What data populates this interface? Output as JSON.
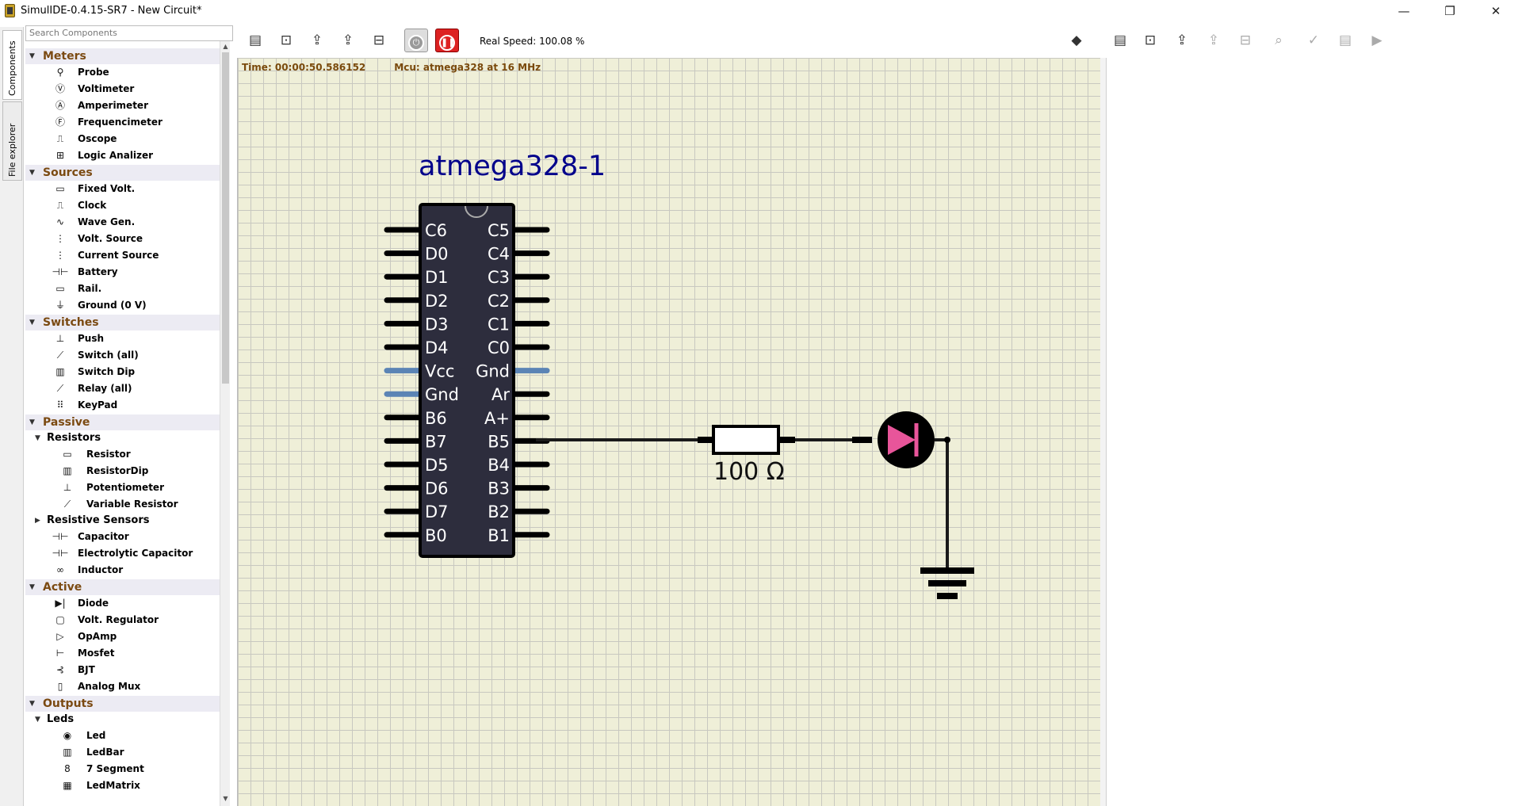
{
  "window": {
    "title": "SimulIDE-0.4.15-SR7  -  New Circuit*",
    "minimize": "—",
    "maximize": "❐",
    "close": "✕"
  },
  "side_tabs": [
    "Components",
    "File explorer"
  ],
  "search": {
    "placeholder": "Search Components"
  },
  "tree": {
    "meters": {
      "label": "Meters",
      "items": [
        "Probe",
        "Voltimeter",
        "Amperimeter",
        "Frequencimeter",
        "Oscope",
        "Logic Analizer"
      ]
    },
    "sources": {
      "label": "Sources",
      "items": [
        "Fixed Volt.",
        "Clock",
        "Wave Gen.",
        "Volt. Source",
        "Current Source",
        "Battery",
        "Rail.",
        "Ground (0 V)"
      ]
    },
    "switches": {
      "label": "Switches",
      "items": [
        "Push",
        "Switch (all)",
        "Switch Dip",
        "Relay (all)",
        "KeyPad"
      ]
    },
    "passive": {
      "label": "Passive",
      "resistors_label": "Resistors",
      "resistors": [
        "Resistor",
        "ResistorDip",
        "Potentiometer",
        "Variable Resistor"
      ],
      "sensors_label": "Resistive Sensors",
      "items": [
        "Capacitor",
        "Electrolytic Capacitor",
        "Inductor"
      ]
    },
    "active": {
      "label": "Active",
      "items": [
        "Diode",
        "Volt. Regulator",
        "OpAmp",
        "Mosfet",
        "BJT",
        "Analog Mux"
      ]
    },
    "outputs": {
      "label": "Outputs",
      "leds_label": "Leds",
      "leds": [
        "Led",
        "LedBar",
        "7 Segment",
        "LedMatrix"
      ]
    }
  },
  "toolbar": {
    "real_speed": "Real Speed: 100.08 %"
  },
  "canvas": {
    "time": "Time: 00:00:50.586152",
    "mcu": "Mcu: atmega328 at 16 MHz",
    "chip_name": "atmega328-1",
    "left_pins": [
      "C6",
      "D0",
      "D1",
      "D2",
      "D3",
      "D4",
      "Vcc",
      "Gnd",
      "B6",
      "B7",
      "D5",
      "D6",
      "D7",
      "B0"
    ],
    "right_pins": [
      "C5",
      "C4",
      "C3",
      "C2",
      "C1",
      "C0",
      "Gnd",
      "Ar",
      "A+",
      "B5",
      "B4",
      "B3",
      "B2",
      "B1"
    ],
    "resistor_value": "100 Ω"
  },
  "colors": {
    "chip_body": "#2d2d3d",
    "led_fill": "#e8559a",
    "canvas_bg": "#efefd8",
    "power_pin": "#5b84b5",
    "stop_button": "#dd2222"
  }
}
